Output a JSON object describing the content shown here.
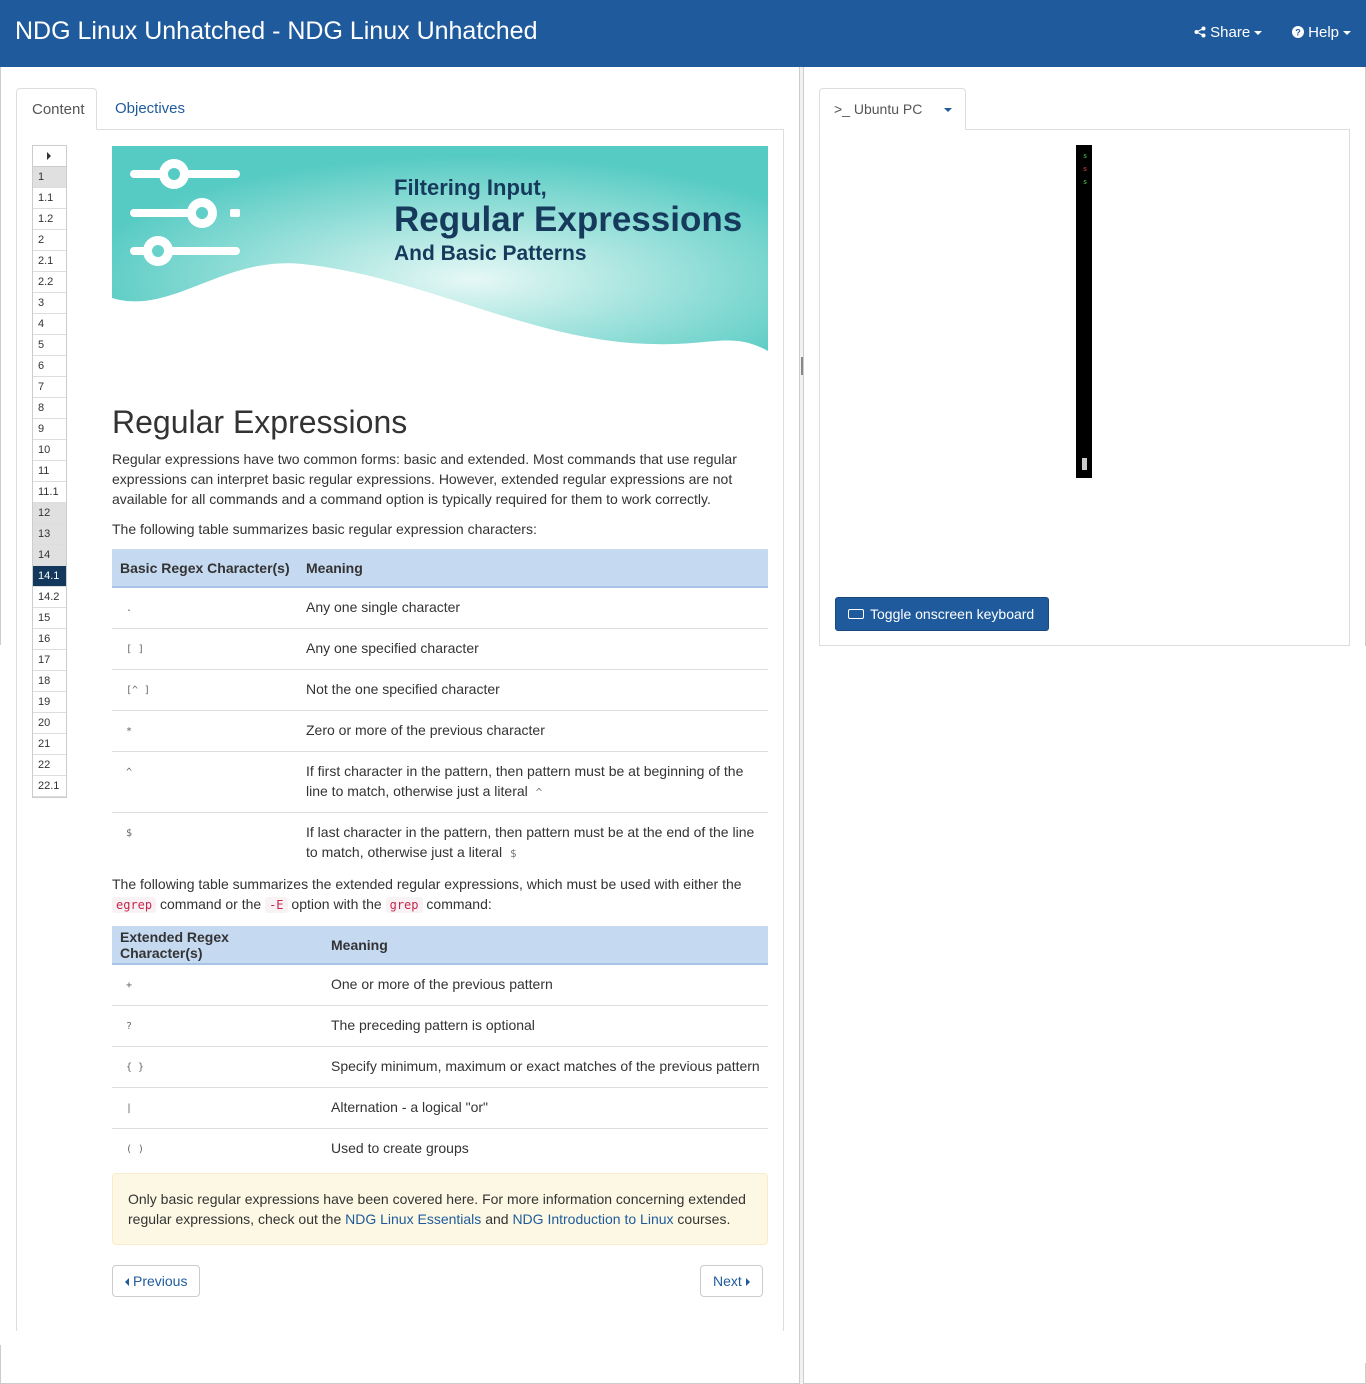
{
  "header": {
    "title": "NDG Linux Unhatched - NDG Linux Unhatched",
    "share_label": "Share",
    "help_label": "Help"
  },
  "left_tabs": {
    "content": "Content",
    "objectives": "Objectives"
  },
  "toc": {
    "items": [
      "1",
      "1.1",
      "1.2",
      "2",
      "2.1",
      "2.2",
      "3",
      "4",
      "5",
      "6",
      "7",
      "8",
      "9",
      "10",
      "11",
      "11.1",
      "12",
      "13",
      "14",
      "14.1",
      "14.2",
      "15",
      "16",
      "17",
      "18",
      "19",
      "20",
      "21",
      "22",
      "22.1"
    ],
    "visited": [
      "1",
      "12",
      "13",
      "14"
    ],
    "current": "14.1"
  },
  "banner": {
    "line1": "Filtering Input,",
    "line2": "Regular Expressions",
    "line3": "And Basic Patterns"
  },
  "page": {
    "heading": "Regular Expressions",
    "intro": "Regular expressions have two common forms: basic and extended. Most commands that use regular expressions can interpret basic regular expressions. However, extended regular expressions are not available for all commands and a command option is typically required for them to work correctly.",
    "basic_lead": "The following table summarizes basic regular expression characters:",
    "extended_lead_1": "The following table summarizes the extended regular expressions, which must be used with either the",
    "egrep": "egrep",
    "extended_lead_2": "command or the",
    "E_opt": "-E",
    "extended_lead_3": "option with the",
    "grep": "grep",
    "extended_lead_4": "command:"
  },
  "basic_table": {
    "headers": [
      "Basic Regex Character(s)",
      "Meaning"
    ],
    "rows": [
      {
        "char": ".",
        "meaning": "Any one single character"
      },
      {
        "char": "[ ]",
        "meaning": "Any one specified character"
      },
      {
        "char": "[^ ]",
        "meaning": "Not the one specified character"
      },
      {
        "char": "*",
        "meaning": "Zero or more of the previous character"
      },
      {
        "char": "^",
        "meaning": "If first character in the pattern, then pattern must be at beginning of the line to match, otherwise just a literal",
        "literal": "^"
      },
      {
        "char": "$",
        "meaning": "If last character in the pattern, then pattern must be at the end of the line to match, otherwise just a literal",
        "literal": "$"
      }
    ]
  },
  "extended_table": {
    "headers": [
      "Extended Regex Character(s)",
      "Meaning"
    ],
    "rows": [
      {
        "char": "+",
        "meaning": "One or more of the previous pattern"
      },
      {
        "char": "?",
        "meaning": "The preceding pattern is optional"
      },
      {
        "char": "{ }",
        "meaning": "Specify minimum, maximum or exact matches of the previous pattern"
      },
      {
        "char": "|",
        "meaning": "Alternation - a logical \"or\""
      },
      {
        "char": "( )",
        "meaning": "Used to create groups"
      }
    ]
  },
  "alert": {
    "text_1": "Only basic regular expressions have been covered here. For more information concerning extended regular expressions, check out the",
    "link_1": "NDG Linux Essentials",
    "text_2": "and",
    "link_2": "NDG Introduction to Linux",
    "text_3": "courses."
  },
  "nav": {
    "previous": "Previous",
    "next": "Next"
  },
  "right_panel": {
    "tab_label": ">_ Ubuntu PC",
    "terminal_lines": [
      "s",
      "s",
      "s"
    ],
    "keyboard_button": "Toggle onscreen keyboard"
  },
  "colors": {
    "navbar": "#1f5b9c",
    "table_header": "#c5d9f1",
    "toc_current": "#14375e",
    "alert_bg": "#fcf8e3"
  }
}
